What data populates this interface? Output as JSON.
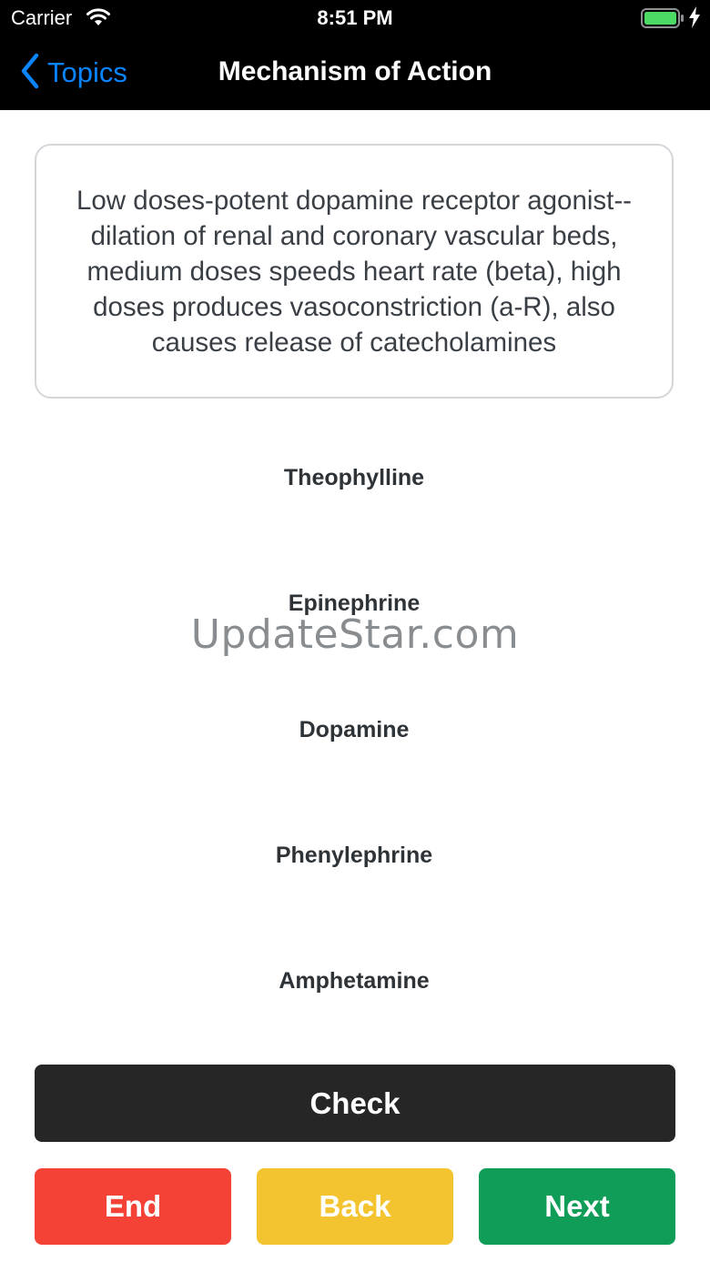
{
  "status_bar": {
    "carrier": "Carrier",
    "time": "8:51 PM",
    "wifi_icon": "wifi-icon",
    "battery_icon": "battery-icon",
    "charging_icon": "charging-bolt-icon"
  },
  "nav": {
    "back_label": "Topics",
    "back_icon": "chevron-left-icon",
    "title": "Mechanism of Action"
  },
  "question": {
    "text": "Low doses-potent dopamine receptor agonist--dilation of renal and coronary vascular beds, medium doses speeds heart rate (beta), high doses produces vasoconstriction (a-R), also causes release of catecholamines"
  },
  "options": [
    {
      "label": "Theophylline"
    },
    {
      "label": "Epinephrine"
    },
    {
      "label": "Dopamine"
    },
    {
      "label": "Phenylephrine"
    },
    {
      "label": "Amphetamine"
    }
  ],
  "watermark": "UpdateStar.com",
  "buttons": {
    "check": "Check",
    "end": "End",
    "back": "Back",
    "next": "Next"
  },
  "colors": {
    "accent": "#0a84ff",
    "check": "#262626",
    "end": "#f44336",
    "back": "#f4c430",
    "next": "#0f9d58",
    "battery": "#4cd964"
  }
}
